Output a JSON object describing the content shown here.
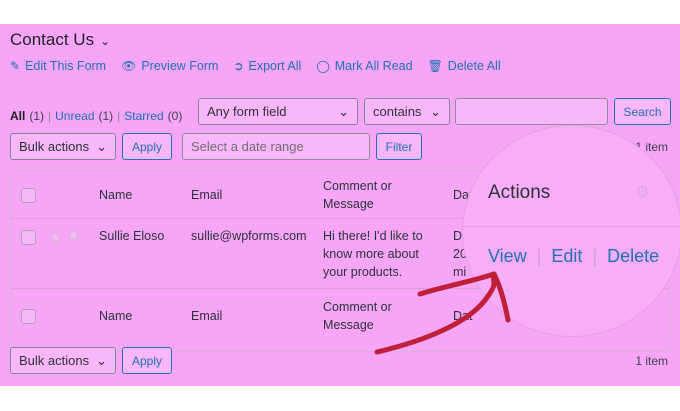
{
  "page": {
    "title": "Contact Us"
  },
  "toolbar": {
    "edit": "Edit This Form",
    "preview": "Preview Form",
    "export": "Export All",
    "mark_read": "Mark All Read",
    "delete": "Delete All"
  },
  "filters": {
    "all": "All",
    "all_count": "(1)",
    "unread": "Unread",
    "unread_count": "(1)",
    "starred": "Starred",
    "starred_count": "(0)",
    "sep": "|"
  },
  "search": {
    "field_select": "Any form field",
    "operator_select": "contains",
    "input_value": "",
    "button": "Search"
  },
  "bulk": {
    "select": "Bulk actions",
    "apply": "Apply",
    "date_placeholder": "Select a date range",
    "filter": "Filter",
    "count": "1 item"
  },
  "table": {
    "headers": {
      "name": "Name",
      "email": "Email",
      "comment": "Comment or\nMessage",
      "date_partial": "Dat"
    },
    "rows": [
      {
        "name": "Sullie Eloso",
        "email": "sullie@wpforms.com",
        "comment": "Hi there! I'd like to\nknow more about\nyour products.",
        "date_partial": "D\n20\nmi"
      }
    ]
  },
  "lens": {
    "title": "Actions",
    "view": "View",
    "edit": "Edit",
    "delete": "Delete"
  },
  "colors": {
    "overlay": "#f7a6f7",
    "link": "#2271b1",
    "arrow": "#c01f3a"
  }
}
